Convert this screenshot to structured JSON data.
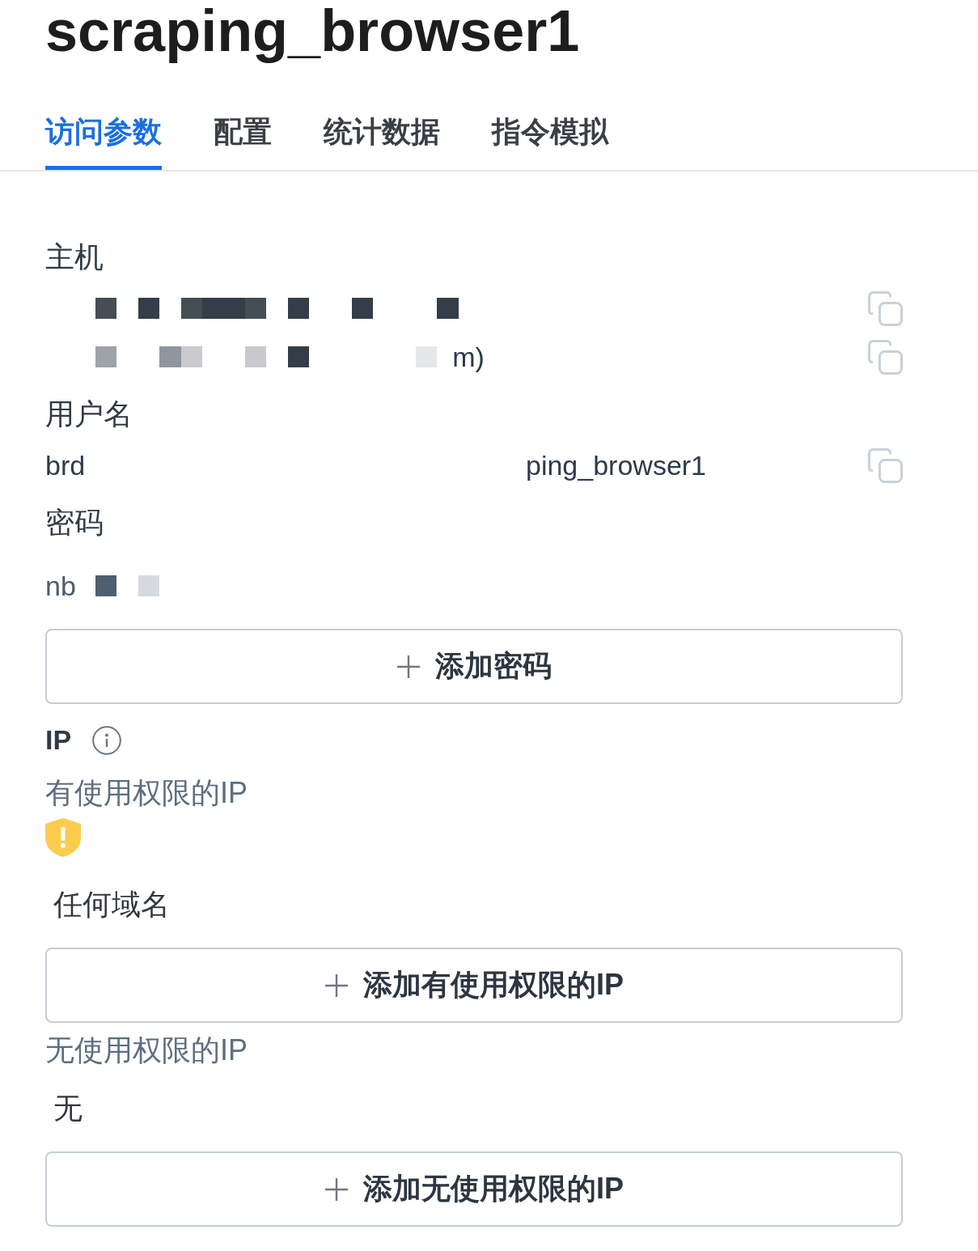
{
  "title": "scraping_browser1",
  "tabs": [
    {
      "label": "访问参数",
      "selected": true
    },
    {
      "label": "配置",
      "selected": false
    },
    {
      "label": "统计数据",
      "selected": false
    },
    {
      "label": "指令模拟",
      "selected": false
    }
  ],
  "fields": [
    {
      "label": "主机",
      "lines": [
        {
          "copyable": true,
          "cells": [
            {
              "kind": "block",
              "color": "#454d55"
            },
            {
              "kind": "blank"
            },
            {
              "kind": "block",
              "color": "#343e49"
            },
            {
              "kind": "blank"
            },
            {
              "kind": "block",
              "color": "#454d55"
            },
            {
              "kind": "block",
              "color": "#343e49"
            },
            {
              "kind": "block",
              "color": "#343e49"
            },
            {
              "kind": "block",
              "color": "#454d55"
            },
            {
              "kind": "blank"
            },
            {
              "kind": "block",
              "color": "#343e49"
            },
            {
              "kind": "blank"
            },
            {
              "kind": "blank"
            },
            {
              "kind": "block",
              "color": "#343e49"
            },
            {
              "kind": "blank"
            },
            {
              "kind": "blank"
            },
            {
              "kind": "blank"
            },
            {
              "kind": "block",
              "color": "#343e49"
            }
          ]
        },
        {
          "copyable": true,
          "cells": [
            {
              "kind": "block",
              "color": "#9ea3a8"
            },
            {
              "kind": "blank"
            },
            {
              "kind": "blank"
            },
            {
              "kind": "block",
              "color": "#8f969e"
            },
            {
              "kind": "block",
              "color": "#c8cacd"
            },
            {
              "kind": "blank"
            },
            {
              "kind": "blank"
            },
            {
              "kind": "block",
              "color": "#c8c9cc"
            },
            {
              "kind": "blank"
            },
            {
              "kind": "block",
              "color": "#343e49"
            },
            {
              "kind": "blank"
            },
            {
              "kind": "blank"
            },
            {
              "kind": "blank"
            },
            {
              "kind": "blank"
            },
            {
              "kind": "blank"
            },
            {
              "kind": "block",
              "color": "#e6e7e8"
            }
          ],
          "text_after": "m)"
        }
      ]
    },
    {
      "label": "用户名",
      "lines": [
        {
          "copyable": true,
          "texts": [
            "brd",
            "ping_browser1"
          ]
        }
      ]
    },
    {
      "label": "密码",
      "lines": [
        {
          "copyable": false,
          "text_before": "nb",
          "cells": [
            {
              "kind": "block",
              "color": "#4f5f72"
            },
            {
              "kind": "blank"
            },
            {
              "kind": "block",
              "color": "#d6d9dd"
            }
          ]
        }
      ]
    }
  ],
  "add_password_button": "添加密码",
  "ip": {
    "label": "IP",
    "lists": [
      {
        "heading": "有使用权限的IP",
        "warning": true,
        "value": "任何域名",
        "button": "添加有使用权限的IP"
      },
      {
        "heading": "无使用权限的IP",
        "warning": false,
        "value": "无",
        "button": "添加无使用权限的IP"
      }
    ]
  }
}
